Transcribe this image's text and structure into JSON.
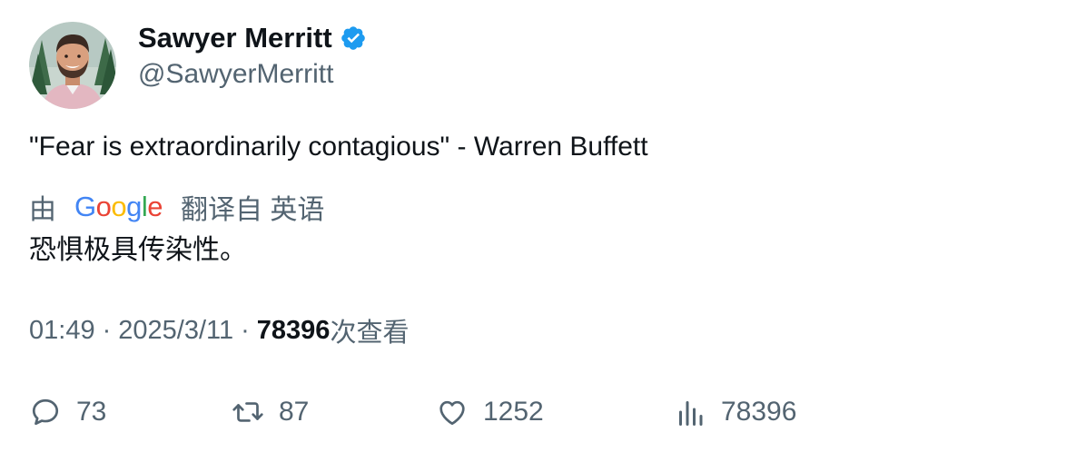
{
  "author": {
    "display_name": "Sawyer Merritt",
    "handle": "@SawyerMerritt",
    "verified_icon": "verified-badge-icon"
  },
  "tweet": {
    "text": "\"Fear is extraordinarily contagious\" - Warren Buffett"
  },
  "translation": {
    "prefix": "由",
    "provider_letters": [
      "G",
      "o",
      "o",
      "g",
      "l",
      "e"
    ],
    "suffix": "翻译自 英语",
    "text": "恐惧极具传染性。"
  },
  "meta": {
    "time": "01:49",
    "separator": "·",
    "date": "2025/3/11",
    "views_count": "78396",
    "views_label": "次查看"
  },
  "actions": {
    "replies": "73",
    "retweets": "87",
    "likes": "1252",
    "views": "78396"
  },
  "colors": {
    "text_primary": "#0f1419",
    "text_secondary": "#536471",
    "verified_blue": "#1d9bf0"
  }
}
